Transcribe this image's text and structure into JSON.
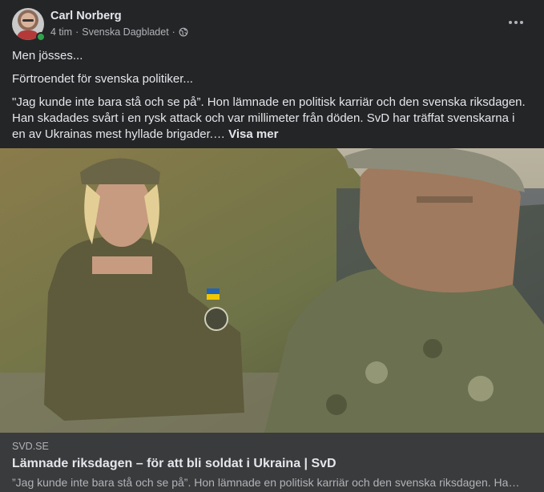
{
  "post": {
    "author": "Carl Norberg",
    "time": "4 tim",
    "separator": "·",
    "group": "Svenska Dagbladet",
    "separator2": "·",
    "privacy_icon": "globe-icon",
    "paragraphs": [
      "Men jösses...",
      "Förtroendet för svenska politiker...",
      "\"Jag kunde inte bara stå och se på”. Hon lämnade en politisk karriär och den svenska riksdagen. Han skadades svårt i en rysk attack och var millimeter från döden. SvD har träffat svenskarna i en av Ukrainas mest hyllade brigader.…"
    ],
    "see_more": "Visa mer"
  },
  "link_preview": {
    "domain": "SVD.SE",
    "title": "Lämnade riksdagen – för att bli soldat i Ukraina | SvD",
    "description": "”Jag kunde inte bara stå och se på”. Hon lämnade en politisk karriär och den svenska riksdagen. Han skadades svårt i en rysk attack och var millimeter från döden."
  },
  "colors": {
    "background": "#242526",
    "link_box": "#3a3b3c",
    "text_primary": "#e4e6eb",
    "text_secondary": "#b0b3b8",
    "online": "#31a24c"
  }
}
